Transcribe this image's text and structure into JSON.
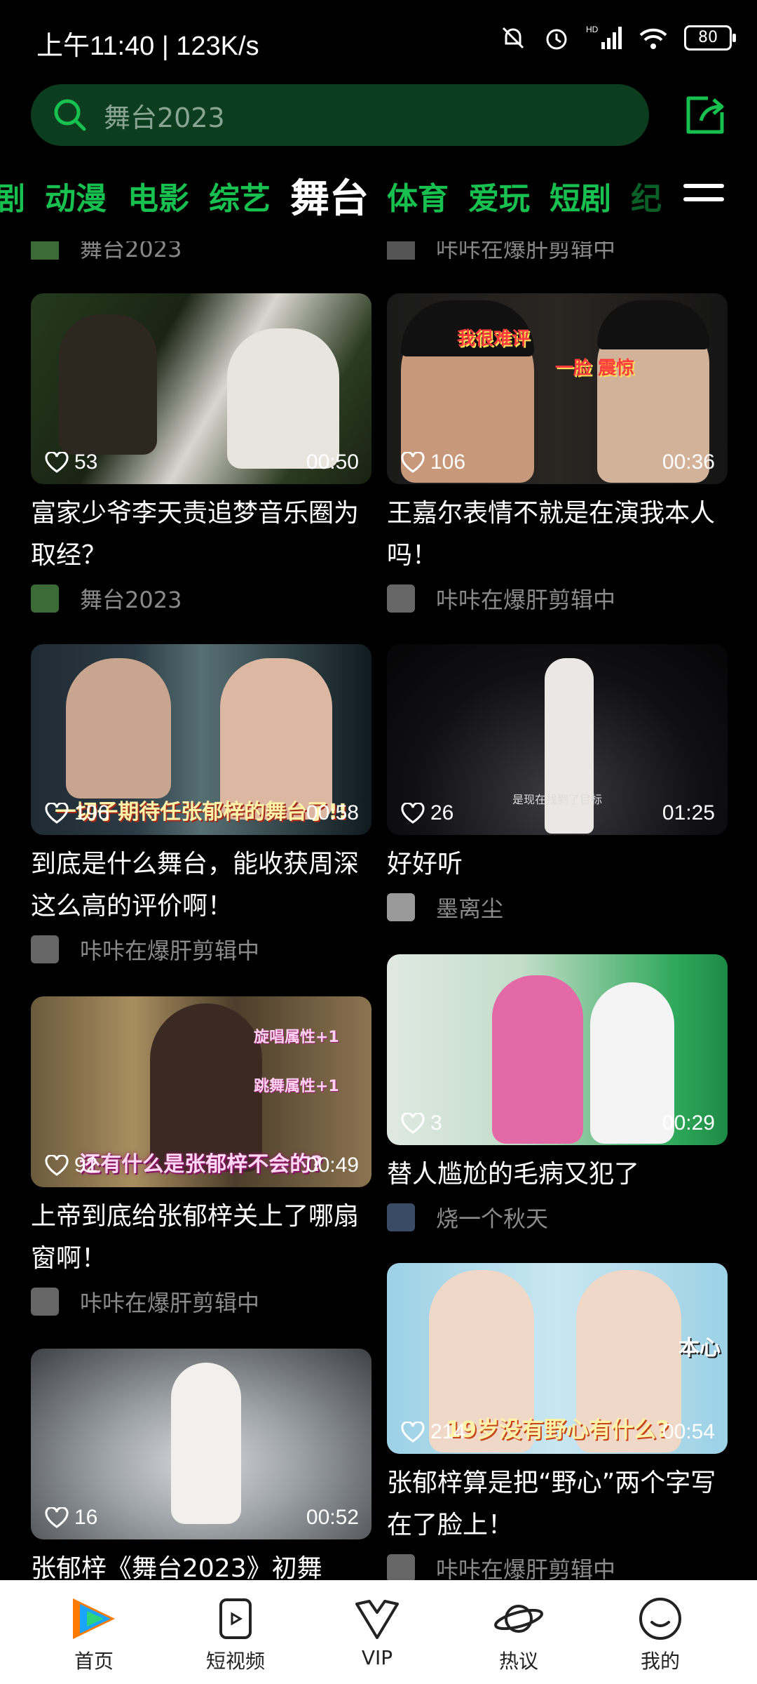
{
  "status": {
    "time": "上午11:40 | 123K/s",
    "battery": "80",
    "signal_label": "HD"
  },
  "search": {
    "placeholder": "舞台2023"
  },
  "tabs": [
    {
      "label": "剧"
    },
    {
      "label": "动漫"
    },
    {
      "label": "电影"
    },
    {
      "label": "综艺"
    },
    {
      "label": "舞台",
      "active": true
    },
    {
      "label": "体育"
    },
    {
      "label": "爱玩"
    },
    {
      "label": "短剧"
    },
    {
      "label": "纪"
    }
  ],
  "partial_row": {
    "left_text": "舞台2023",
    "right_text": "咔咔在爆肝剪辑中"
  },
  "cards_left": [
    {
      "likes": "53",
      "duration": "00:50",
      "title": "富家少爷李天责追梦音乐圈为取经？",
      "author": "舞台2023"
    },
    {
      "likes": "196",
      "duration": "00:58",
      "caption": "一切子期待任张郁梓的舞台了!!",
      "title": "到底是什么舞台，能收获周深这么高的评价啊！",
      "author": "咔咔在爆肝剪辑中"
    },
    {
      "likes": "92",
      "duration": "00:49",
      "caption": "还有什么是张郁梓不会的?",
      "caption2": "旋唱属性+1",
      "caption3": "跳舞属性+1",
      "title": "上帝到底给张郁梓关上了哪扇窗啊！",
      "author": "咔咔在爆肝剪辑中"
    },
    {
      "likes": "16",
      "duration": "00:52",
      "title": "张郁梓《舞台2023》初舞",
      "author": ""
    }
  ],
  "cards_right": [
    {
      "likes": "106",
      "duration": "00:36",
      "caption_a": "我很难评",
      "caption_b": "一脸 震惊",
      "title": "王嘉尔表情不就是在演我本人吗！",
      "author": "咔咔在爆肝剪辑中"
    },
    {
      "likes": "26",
      "duration": "01:25",
      "subtitle": "是现在找到了目标",
      "title": "好好听",
      "author": "墨离尘"
    },
    {
      "likes": "3",
      "duration": "00:29",
      "title": "替人尴尬的毛病又犯了",
      "author": "烧一个秋天"
    },
    {
      "likes": "214",
      "duration": "00:54",
      "caption": "19岁没有野心有什么?",
      "caption2": "本心",
      "title": "张郁梓算是把“野心”两个字写在了脸上！",
      "author": "咔咔在爆肝剪辑中"
    }
  ],
  "bottom_nav": [
    {
      "label": "首页",
      "icon": "tencent-video-logo-icon",
      "active": true
    },
    {
      "label": "短视频",
      "icon": "short-video-icon"
    },
    {
      "label": "VIP",
      "icon": "vip-icon"
    },
    {
      "label": "热议",
      "icon": "planet-icon"
    },
    {
      "label": "我的",
      "icon": "smiley-profile-icon"
    }
  ],
  "colors": {
    "accent": "#17c04f",
    "search_bg": "#0b3d1e"
  }
}
